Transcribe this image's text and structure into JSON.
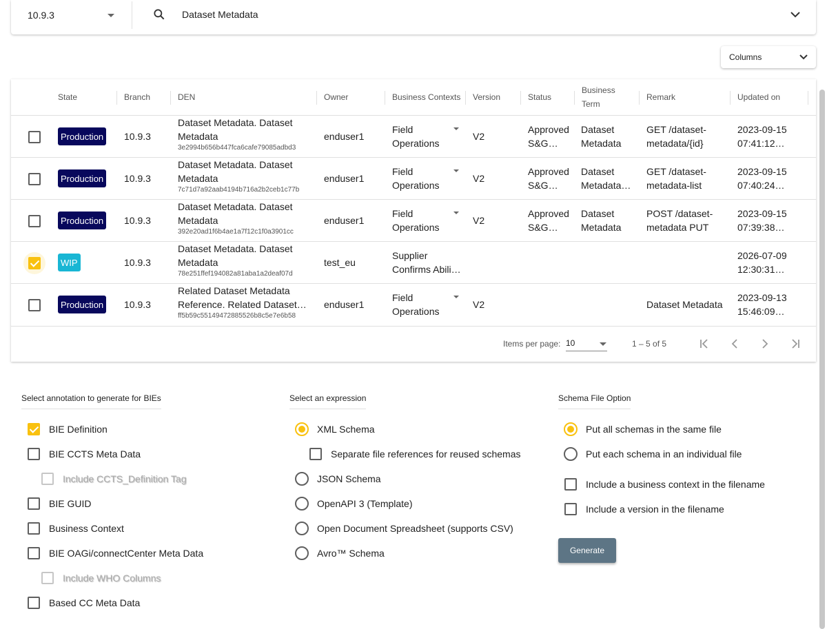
{
  "search": {
    "branch": "10.9.3",
    "query": "Dataset Metadata"
  },
  "columns_button": "Columns",
  "table": {
    "headers": {
      "state": "State",
      "branch": "Branch",
      "den": "DEN",
      "owner": "Owner",
      "business_contexts": "Business Contexts",
      "version": "Version",
      "status": "Status",
      "business_term": "Business Term",
      "remark": "Remark",
      "updated_on": "Updated on"
    },
    "rows": [
      {
        "checked": false,
        "state": "Production",
        "branch": "10.9.3",
        "den": "Dataset Metadata. Dataset Metadata",
        "guid": "3e2994b656b447fca6cafe79085adbd3",
        "owner": "enduser1",
        "context": "Field Operations",
        "version": "V2",
        "status": "Approved S&G…",
        "term": "Dataset Metadata",
        "remark": "GET /dataset-metadata/{id}",
        "updated": "2023-09-15 07:41:12…"
      },
      {
        "checked": false,
        "state": "Production",
        "branch": "10.9.3",
        "den": "Dataset Metadata. Dataset Metadata",
        "guid": "7c71d7a92aab4194b716a2b2ceb1c77b",
        "owner": "enduser1",
        "context": "Field Operations",
        "version": "V2",
        "status": "Approved S&G…",
        "term": "Dataset Metadata…",
        "remark": "GET /dataset-metadata-list",
        "updated": "2023-09-15 07:40:24…"
      },
      {
        "checked": false,
        "state": "Production",
        "branch": "10.9.3",
        "den": "Dataset Metadata. Dataset Metadata",
        "guid": "392e20ad1f6b4ae1a7f12c1f0a3901cc",
        "owner": "enduser1",
        "context": "Field Operations",
        "version": "V2",
        "status": "Approved S&G…",
        "term": "Dataset Metadata",
        "remark": "POST /dataset-metadata PUT",
        "updated": "2023-09-15 07:39:38…"
      },
      {
        "checked": true,
        "state": "WIP",
        "branch": "10.9.3",
        "den": "Dataset Metadata. Dataset Metadata",
        "guid": "78e251ffef194082a81aba1a2deaf07d",
        "owner": "test_eu",
        "context": "Supplier Confirms Abili…",
        "version": "",
        "status": "",
        "term": "",
        "remark": "",
        "updated": "2026-07-09 12:30:31…"
      },
      {
        "checked": false,
        "state": "Production",
        "branch": "10.9.3",
        "den": "Related Dataset Metadata Reference. Related Dataset…",
        "guid": "ff5b59c55149472885526b8c5e7e6b58",
        "owner": "enduser1",
        "context": "Field Operations",
        "version": "V2",
        "status": "",
        "term": "",
        "remark": "Dataset Metadata",
        "updated": "2023-09-13 15:46:09…"
      }
    ]
  },
  "paginator": {
    "items_per_page_label": "Items per page:",
    "page_size": "10",
    "range": "1 – 5 of 5"
  },
  "annotations": {
    "title": "Select annotation to generate for BIEs",
    "options": [
      {
        "label": "BIE Definition",
        "checked": true,
        "disabled": false
      },
      {
        "label": "BIE CCTS Meta Data",
        "checked": false,
        "disabled": false
      },
      {
        "label": "Include CCTS_Definition Tag",
        "checked": false,
        "disabled": true
      },
      {
        "label": "BIE GUID",
        "checked": false,
        "disabled": false
      },
      {
        "label": "Business Context",
        "checked": false,
        "disabled": false
      },
      {
        "label": "BIE OAGi/connectCenter Meta Data",
        "checked": false,
        "disabled": false
      },
      {
        "label": "Include WHO Columns",
        "checked": false,
        "disabled": true
      },
      {
        "label": "Based CC Meta Data",
        "checked": false,
        "disabled": false
      }
    ]
  },
  "expression": {
    "title": "Select an expression",
    "xml": "XML Schema",
    "separate": "Separate file references for reused schemas",
    "json": "JSON Schema",
    "openapi": "OpenAPI 3 (Template)",
    "ods": "Open Document Spreadsheet (supports CSV)",
    "avro": "Avro™ Schema"
  },
  "schema_file": {
    "title": "Schema File Option",
    "same_file": "Put all schemas in the same file",
    "individual": "Put each schema in an individual file",
    "include_context": "Include a business context in the filename",
    "include_version": "Include a version in the filename"
  },
  "generate_button": "Generate",
  "colors": {
    "accent": "#f9c10f",
    "production": "#08085c",
    "wip": "#19b6d4",
    "generate": "#5d7585"
  }
}
